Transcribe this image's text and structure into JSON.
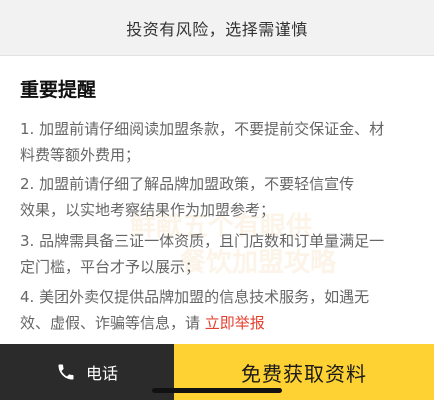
{
  "banner": {
    "text": "投资有风险，选择需谨慎"
  },
  "notice": {
    "title": "重要提醒",
    "items": [
      {
        "lines": [
          "1. 加盟前请仔细阅读加盟条款，不要提前交保证金、材",
          "料费等额外费用；"
        ]
      },
      {
        "lines": [
          "2. 加盟前请仔细了解品牌加盟政策，不要轻信宣传",
          "效果，以实地考察结果作为加盟参考；"
        ]
      },
      {
        "lines": [
          "3. 品牌需具备三证一体资质，且门店数和订单量满足一",
          "定门槛，平台才予以展示；"
        ]
      },
      {
        "lines": [
          "4. 美团外卖仅提供品牌加盟的信息技术服务，如遇无",
          "效、虚假、诈骗等信息，请 "
        ],
        "link": "立即举报"
      }
    ]
  },
  "watermark": {
    "line1": "鲜献五个有眼供",
    "line2": "餐饮加盟攻略"
  },
  "bottom": {
    "call_label": "电话",
    "cta_label": "免费获取资料"
  },
  "colors": {
    "cta_bg": "#ffd233",
    "call_bg": "#2b2b2b",
    "link": "#e5402f"
  },
  "icons": {
    "call": "phone-icon"
  }
}
